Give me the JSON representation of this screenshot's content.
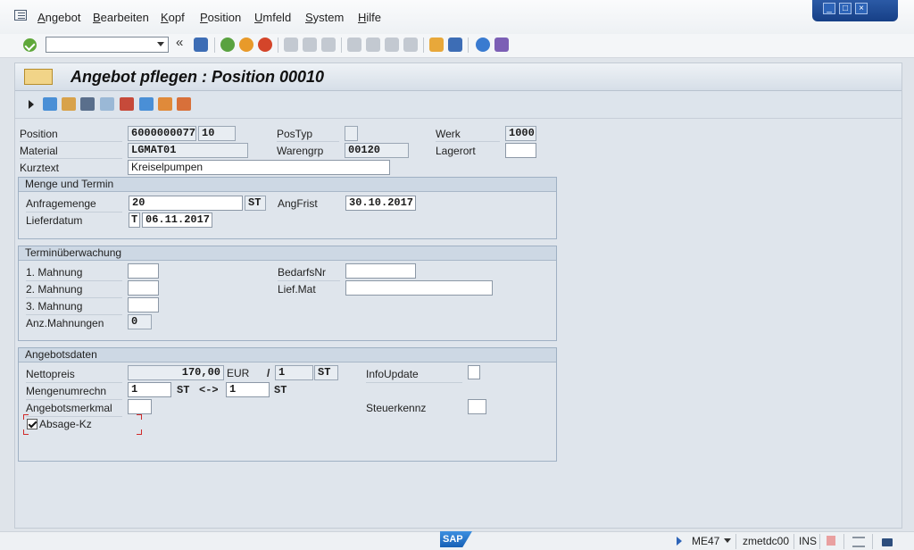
{
  "menu": {
    "items": [
      {
        "first": "A",
        "rest": "ngebot"
      },
      {
        "first": "B",
        "rest": "earbeiten"
      },
      {
        "first": "K",
        "rest": "opf"
      },
      {
        "first": "P",
        "rest": "osition"
      },
      {
        "first": "U",
        "rest": "mfeld"
      },
      {
        "first": "S",
        "rest": "ystem"
      },
      {
        "first": "H",
        "rest": "ilfe"
      }
    ]
  },
  "toolbar": {
    "command_value": "",
    "back_glyph": "«"
  },
  "screen": {
    "title": "Angebot pflegen : Position 00010"
  },
  "header": {
    "position_label": "Position",
    "position_doc": "6000000077",
    "position_item": "10",
    "material_label": "Material",
    "material_value": "LGMAT01",
    "kurztext_label": "Kurztext",
    "kurztext_value": "Kreiselpumpen",
    "postyp_label": "PosTyp",
    "postyp_value": "",
    "warengrp_label": "Warengrp",
    "warengrp_value": "00120",
    "werk_label": "Werk",
    "werk_value": "1000",
    "lagerort_label": "Lagerort",
    "lagerort_value": ""
  },
  "menge": {
    "title": "Menge und Termin",
    "anfragemenge_label": "Anfragemenge",
    "anfragemenge_value": "20",
    "anfragemenge_unit": "ST",
    "angfrist_label": "AngFrist",
    "angfrist_value": "30.10.2017",
    "lieferdatum_label": "Lieferdatum",
    "lieferdatum_type": "T",
    "lieferdatum_value": "06.11.2017"
  },
  "termin": {
    "title": "Terminüberwachung",
    "mahnung1_label": "1. Mahnung",
    "mahnung2_label": "2. Mahnung",
    "mahnung3_label": "3. Mahnung",
    "anz_label": "Anz.Mahnungen",
    "anz_value": "0",
    "bedarfsnr_label": "BedarfsNr",
    "liefmat_label": "Lief.Mat"
  },
  "angebot": {
    "title": "Angebotsdaten",
    "nettopreis_label": "Nettopreis",
    "nettopreis_value": "170,00",
    "currency": "EUR",
    "per_sep": "/",
    "per_value": "1",
    "per_unit": "ST",
    "mengenumrechn_label": "Mengenumrechn",
    "umrechn_left_value": "1",
    "umrechn_left_unit": "ST",
    "umrechn_arrow": "<->",
    "umrechn_right_value": "1",
    "umrechn_right_unit": "ST",
    "merkmal_label": "Angebotsmerkmal",
    "absage_label": "Absage-Kz",
    "absage_checked": true,
    "infoupdate_label": "InfoUpdate",
    "steuerkennz_label": "Steuerkennz"
  },
  "status": {
    "logo": "SAP",
    "transaction": "ME47",
    "server": "zmetdc00",
    "mode": "INS"
  },
  "colors": {
    "accent": "#1660b5",
    "focus": "#d02a2a",
    "ok_green": "#5fa83a"
  }
}
